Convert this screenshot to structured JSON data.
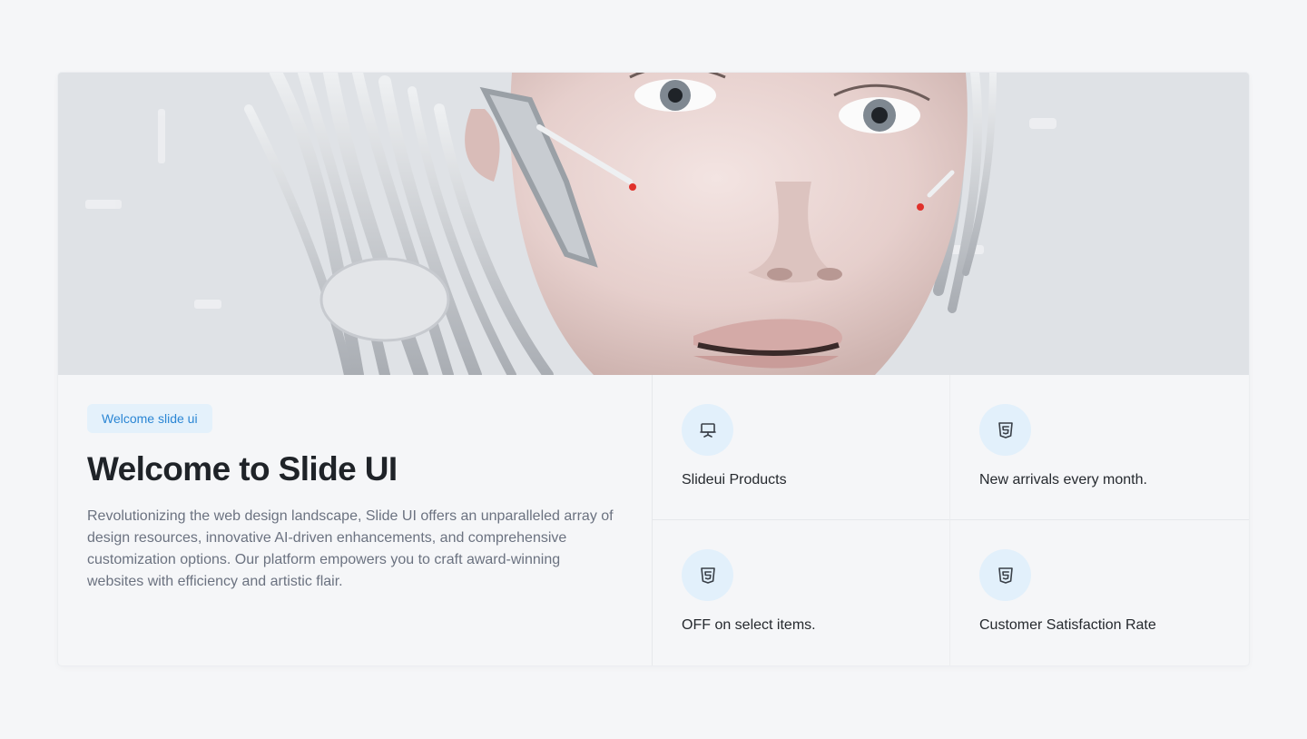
{
  "hero": {
    "image_alt": "Humanoid android face with exposed wires"
  },
  "intro": {
    "badge": "Welcome slide ui",
    "title": "Welcome to Slide UI",
    "description": "Revolutionizing the web design landscape, Slide UI offers an unparalleled array of design resources, innovative AI-driven enhancements, and comprehensive customization options. Our platform empowers you to craft award-winning websites with efficiency and artistic flair."
  },
  "features": [
    {
      "icon": "presentation-icon",
      "label": "Slideui Products"
    },
    {
      "icon": "html5-icon",
      "label": "New arrivals every month."
    },
    {
      "icon": "html5-icon",
      "label": "OFF on select items."
    },
    {
      "icon": "html5-icon",
      "label": "Customer Satisfaction Rate"
    }
  ],
  "colors": {
    "accent": "#2b86d4",
    "badge_bg": "#e4f1fb",
    "icon_bg": "#e2f0fb",
    "page_bg": "#f5f6f8"
  }
}
